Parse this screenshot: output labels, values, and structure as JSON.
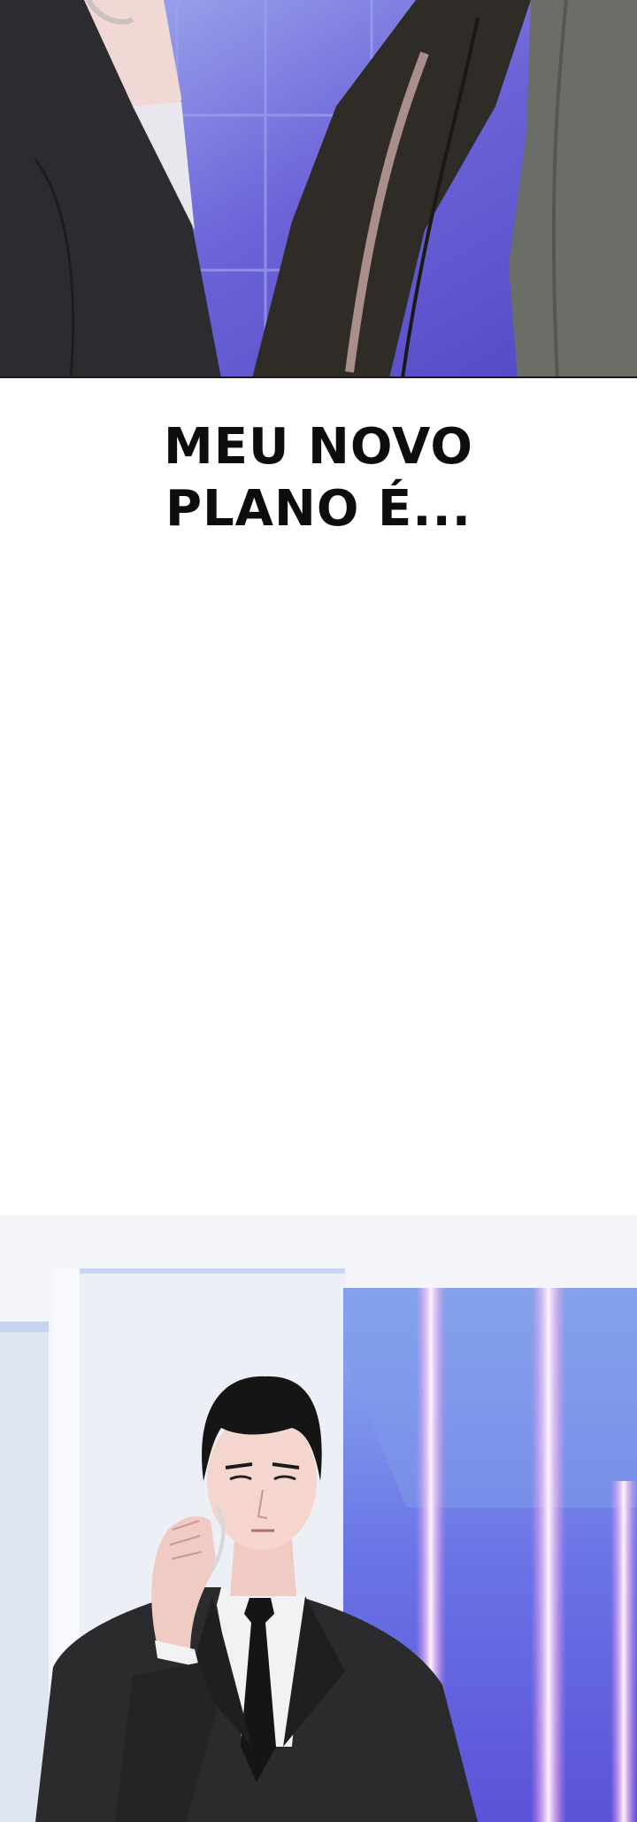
{
  "caption": {
    "line1": "MEU NOVO",
    "line2": "PLANO É..."
  },
  "colors": {
    "top_wall": "#6f6ad6",
    "suit": "#2b2b2e",
    "coat": "#2e2b28",
    "gray_coat": "#6b6e66",
    "bottom_glass": "#6f7be6",
    "neon": "#ffd6f6"
  }
}
